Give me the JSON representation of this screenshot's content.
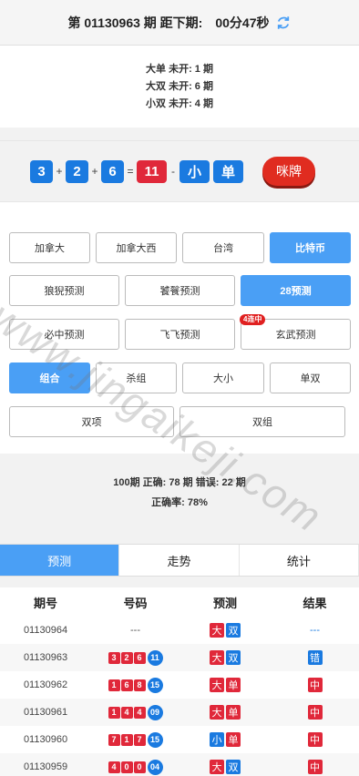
{
  "header": {
    "issue_label": "第 01130963 期 距下期:",
    "countdown": "00分47秒"
  },
  "miss_stats": [
    "大单 未开: 1 期",
    "大双 未开: 6 期",
    "小双 未开: 4 期"
  ],
  "result": {
    "n1": "3",
    "op1": "+",
    "n2": "2",
    "op2": "+",
    "n3": "6",
    "eq": "=",
    "sum": "11",
    "dash": "-",
    "size": "小",
    "parity": "单",
    "mipai_label": "咪牌"
  },
  "region_tabs": [
    "加拿大",
    "加拿大西",
    "台湾",
    "比特币"
  ],
  "predictors": [
    "狼猊预测",
    "饕餮预测",
    "28预测",
    "必中预测",
    "飞飞预测",
    "玄武预测"
  ],
  "predictor_badge": "4连中",
  "types": [
    "组合",
    "杀组",
    "大小",
    "单双",
    "双项",
    "双组"
  ],
  "stats": {
    "line1": "100期 正确: 78 期 错误: 22 期",
    "line2": "正确率: 78%"
  },
  "bottom_tabs": [
    "预测",
    "走势",
    "统计"
  ],
  "table": {
    "headers": [
      "期号",
      "号码",
      "预测",
      "结果"
    ],
    "rows": [
      {
        "issue": "01130964",
        "nums": [],
        "sum": "",
        "pred": [
          "大",
          "双"
        ],
        "result": "---"
      },
      {
        "issue": "01130963",
        "nums": [
          "3",
          "2",
          "6"
        ],
        "sum": "11",
        "pred": [
          "大",
          "双"
        ],
        "result": "错"
      },
      {
        "issue": "01130962",
        "nums": [
          "1",
          "6",
          "8"
        ],
        "sum": "15",
        "pred": [
          "大",
          "单"
        ],
        "result": "中"
      },
      {
        "issue": "01130961",
        "nums": [
          "1",
          "4",
          "4"
        ],
        "sum": "09",
        "pred": [
          "大",
          "单"
        ],
        "result": "中"
      },
      {
        "issue": "01130960",
        "nums": [
          "7",
          "1",
          "7"
        ],
        "sum": "15",
        "pred": [
          "小",
          "单"
        ],
        "result": "中"
      },
      {
        "issue": "01130959",
        "nums": [
          "4",
          "0",
          "0"
        ],
        "sum": "04",
        "pred": [
          "大",
          "双"
        ],
        "result": "中"
      }
    ],
    "pending_nums": "---"
  },
  "watermark": "www.jingaikeji.com",
  "colors": {
    "blue": "#1a7ae0",
    "red": "#e0283a",
    "active": "#4a9ff5"
  }
}
